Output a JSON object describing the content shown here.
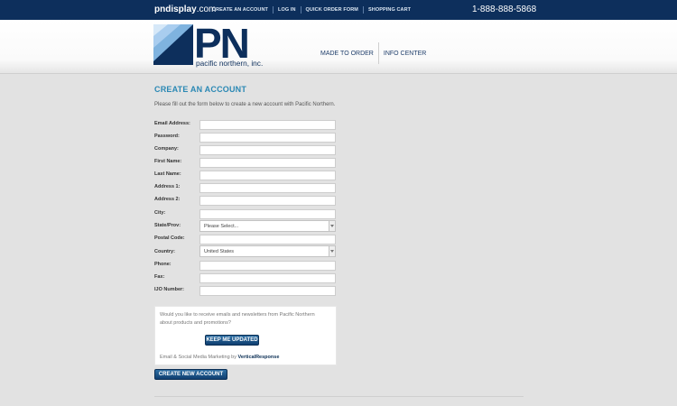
{
  "topbar": {
    "domain_bold": "pndisplay",
    "domain_rest": ".com",
    "nav": [
      "CREATE AN ACCOUNT",
      "LOG IN",
      "QUICK ORDER FORM",
      "SHOPPING CART"
    ],
    "phone": "1-888-888-5868"
  },
  "logo": {
    "letters": "PN",
    "company": "pacific northern, inc."
  },
  "mainnav": [
    "MADE TO ORDER",
    "INFO CENTER"
  ],
  "page": {
    "title": "CREATE AN ACCOUNT",
    "intro": "Please fill out the form below to create a new account with Pacific Northern."
  },
  "form": {
    "email_label": "Email Address:",
    "email_value": "",
    "password_label": "Password:",
    "password_value": "",
    "company_label": "Company:",
    "company_value": "",
    "first_name_label": "First Name:",
    "first_name_value": "",
    "last_name_label": "Last Name:",
    "last_name_value": "",
    "address1_label": "Address 1:",
    "address1_value": "",
    "address2_label": "Address 2:",
    "address2_value": "",
    "city_label": "City:",
    "city_value": "",
    "state_label": "State/Prov:",
    "state_value": "Please Select...",
    "postal_label": "Postal Code:",
    "postal_value": "",
    "country_label": "Country:",
    "country_value": "United States",
    "phone_label": "Phone:",
    "phone_value": "",
    "fax_label": "Fax:",
    "fax_value": "",
    "ijo_label": "IJO Number:",
    "ijo_value": ""
  },
  "newsletter": {
    "question": "Would you like to receive emails and newsletters from Pacific Northern about products and promotions?",
    "button": "KEEP ME UPDATED",
    "credit_prefix": "Email & Social Media Marketing by ",
    "credit_brand": "VerticalResponse"
  },
  "submit": {
    "label": "CREATE NEW ACCOUNT"
  },
  "colors": {
    "topbar": "#0d2f5c",
    "accent_title": "#2a88b4",
    "button": "#1b5a8e",
    "logo_light": "#6fa5d8",
    "logo_dark": "#0d2f5c"
  }
}
